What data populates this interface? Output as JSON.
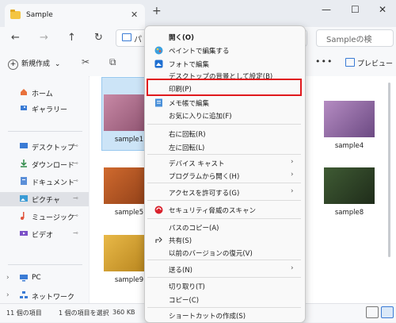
{
  "window": {
    "tab_title": "Sample",
    "tab_close": "✕",
    "new_tab": "+",
    "minimize": "—",
    "maximize": "☐",
    "close": "✕"
  },
  "nav": {
    "back": "←",
    "forward": "→",
    "up": "↑",
    "refresh": "↻",
    "address_text": "パ",
    "search_placeholder": "Sampleの検"
  },
  "toolbar": {
    "new_label": "新規作成",
    "new_chevron": "⌄",
    "more": "•••",
    "preview_label": "プレビュー"
  },
  "sidebar": {
    "home": "ホーム",
    "gallery": "ギャラリー",
    "desktop": "デスクトップ",
    "downloads": "ダウンロード",
    "documents": "ドキュメント",
    "pictures": "ピクチャ",
    "music": "ミュージック",
    "videos": "ビデオ",
    "pc": "PC",
    "network": "ネットワーク",
    "pin": "📌",
    "chevron": "›"
  },
  "files": [
    {
      "name": "sample1",
      "colors": [
        "#c889a6",
        "#8a4f6c"
      ]
    },
    {
      "name": "sample4",
      "colors": [
        "#b58cc2",
        "#6c4a83"
      ]
    },
    {
      "name": "sample5",
      "colors": [
        "#d06a2e",
        "#8c3d17"
      ]
    },
    {
      "name": "sample8",
      "colors": [
        "#3f5b34",
        "#1f2c1a"
      ]
    },
    {
      "name": "sample9",
      "colors": [
        "#e9b948",
        "#b3801a"
      ]
    }
  ],
  "status": {
    "count": "11 個の項目",
    "selected": "1 個の項目を選択",
    "size": "360 KB"
  },
  "context_menu": {
    "items": [
      {
        "label": "開く(O)"
      },
      {
        "label": "ペイントで編集する"
      },
      {
        "label": "フォトで編集"
      },
      {
        "label": "デスクトップの背景として設定(B)"
      },
      {
        "label": "印刷(P)"
      },
      {
        "label": "メモ帳で編集"
      },
      {
        "label": "お気に入りに追加(F)"
      },
      {
        "label": "右に回転(R)"
      },
      {
        "label": "左に回転(L)"
      },
      {
        "label": "デバイス キャスト"
      },
      {
        "label": "プログラムから開く(H)"
      },
      {
        "label": "アクセスを許可する(G)"
      },
      {
        "label": "セキュリティ脅威のスキャン"
      },
      {
        "label": "パスのコピー(A)"
      },
      {
        "label": "共有(S)"
      },
      {
        "label": "以前のバージョンの復元(V)"
      },
      {
        "label": "送る(N)"
      },
      {
        "label": "切り取り(T)"
      },
      {
        "label": "コピー(C)"
      },
      {
        "label": "ショートカットの作成(S)"
      }
    ],
    "arrow": "›"
  },
  "colors": {
    "highlight": "#e0191d",
    "selection": "#cce4f7",
    "accent": "#3a7bd5"
  }
}
